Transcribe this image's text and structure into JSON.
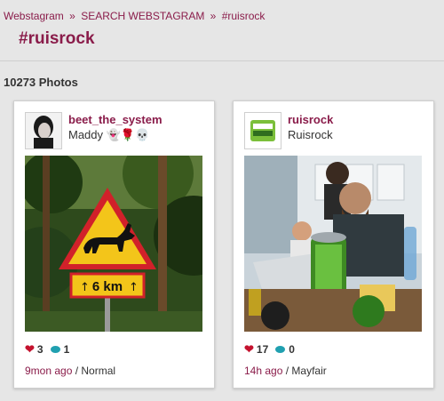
{
  "breadcrumb": {
    "items": [
      "Webstagram",
      "SEARCH WEBSTAGRAM",
      "#ruisrock"
    ],
    "separator": "»"
  },
  "page": {
    "title": "#ruisrock",
    "photo_count": "10273 Photos"
  },
  "posts": [
    {
      "username": "beet_the_system",
      "fullname": "Maddy 👻🌹💀",
      "likes": "3",
      "comments": "1",
      "time": "9mon ago",
      "filter": "Normal",
      "sign_text": "6 km"
    },
    {
      "username": "ruisrock",
      "fullname": "Ruisrock",
      "likes": "17",
      "comments": "0",
      "time": "14h ago",
      "filter": "Mayfair"
    }
  ],
  "colors": {
    "accent": "#8a1c4a",
    "like": "#c4122e",
    "comment": "#20a0b0",
    "background": "#e6e6e6"
  },
  "icons": {
    "like": "heart-icon",
    "comment": "comment-bubble-icon"
  }
}
